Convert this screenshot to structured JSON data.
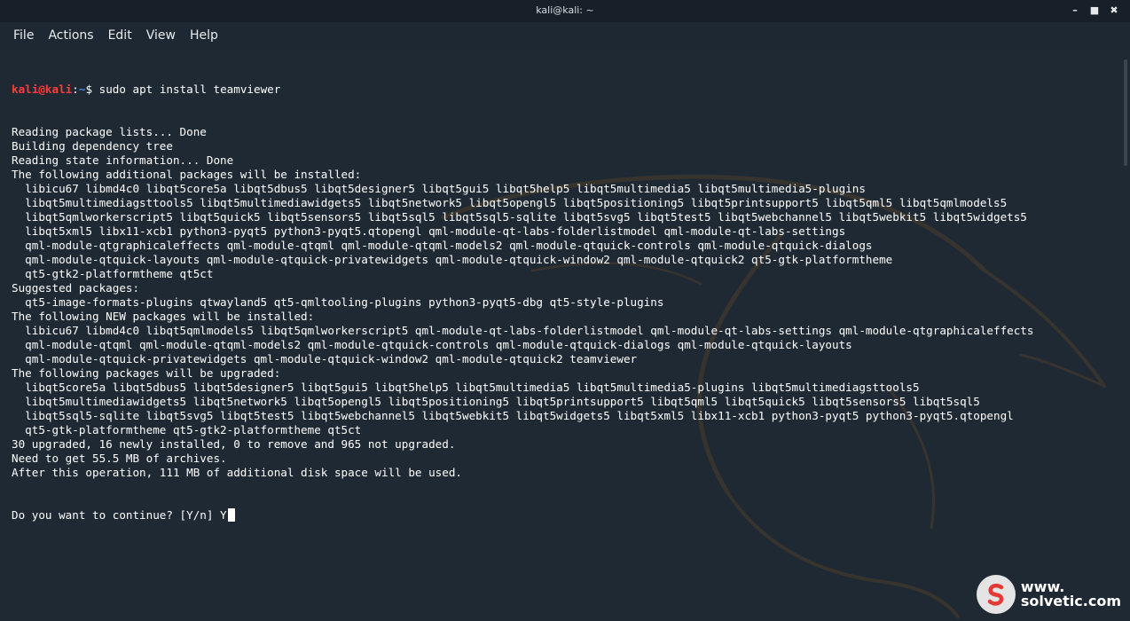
{
  "window": {
    "title": "kali@kali: ~",
    "controls": {
      "minimize": "–",
      "maximize": "■",
      "close": "✖"
    }
  },
  "menu": [
    {
      "label": "File"
    },
    {
      "label": "Actions"
    },
    {
      "label": "Edit"
    },
    {
      "label": "View"
    },
    {
      "label": "Help"
    }
  ],
  "prompt": {
    "user": "kali@kali",
    "separator": ":",
    "path": "~",
    "symbol": "$ ",
    "command": "sudo apt install teamviewer"
  },
  "output_lines": [
    "Reading package lists... Done",
    "Building dependency tree",
    "Reading state information... Done",
    "The following additional packages will be installed:",
    "  libicu67 libmd4c0 libqt5core5a libqt5dbus5 libqt5designer5 libqt5gui5 libqt5help5 libqt5multimedia5 libqt5multimedia5-plugins",
    "  libqt5multimediagsttools5 libqt5multimediawidgets5 libqt5network5 libqt5opengl5 libqt5positioning5 libqt5printsupport5 libqt5qml5 libqt5qmlmodels5",
    "  libqt5qmlworkerscript5 libqt5quick5 libqt5sensors5 libqt5sql5 libqt5sql5-sqlite libqt5svg5 libqt5test5 libqt5webchannel5 libqt5webkit5 libqt5widgets5",
    "  libqt5xml5 libx11-xcb1 python3-pyqt5 python3-pyqt5.qtopengl qml-module-qt-labs-folderlistmodel qml-module-qt-labs-settings",
    "  qml-module-qtgraphicaleffects qml-module-qtqml qml-module-qtqml-models2 qml-module-qtquick-controls qml-module-qtquick-dialogs",
    "  qml-module-qtquick-layouts qml-module-qtquick-privatewidgets qml-module-qtquick-window2 qml-module-qtquick2 qt5-gtk-platformtheme",
    "  qt5-gtk2-platformtheme qt5ct",
    "Suggested packages:",
    "  qt5-image-formats-plugins qtwayland5 qt5-qmltooling-plugins python3-pyqt5-dbg qt5-style-plugins",
    "The following NEW packages will be installed:",
    "  libicu67 libmd4c0 libqt5qmlmodels5 libqt5qmlworkerscript5 qml-module-qt-labs-folderlistmodel qml-module-qt-labs-settings qml-module-qtgraphicaleffects",
    "  qml-module-qtqml qml-module-qtqml-models2 qml-module-qtquick-controls qml-module-qtquick-dialogs qml-module-qtquick-layouts",
    "  qml-module-qtquick-privatewidgets qml-module-qtquick-window2 qml-module-qtquick2 teamviewer",
    "The following packages will be upgraded:",
    "  libqt5core5a libqt5dbus5 libqt5designer5 libqt5gui5 libqt5help5 libqt5multimedia5 libqt5multimedia5-plugins libqt5multimediagsttools5",
    "  libqt5multimediawidgets5 libqt5network5 libqt5opengl5 libqt5positioning5 libqt5printsupport5 libqt5qml5 libqt5quick5 libqt5sensors5 libqt5sql5",
    "  libqt5sql5-sqlite libqt5svg5 libqt5test5 libqt5webchannel5 libqt5webkit5 libqt5widgets5 libqt5xml5 libx11-xcb1 python3-pyqt5 python3-pyqt5.qtopengl",
    "  qt5-gtk-platformtheme qt5-gtk2-platformtheme qt5ct",
    "30 upgraded, 16 newly installed, 0 to remove and 965 not upgraded.",
    "Need to get 55.5 MB of archives.",
    "After this operation, 111 MB of additional disk space will be used."
  ],
  "question": {
    "text": "Do you want to continue? [Y/n] ",
    "answer": "Y"
  },
  "watermark": {
    "line1": "www.",
    "line2": "solvetic.com"
  },
  "colors": {
    "background": "#1f2933",
    "prompt_user": "#ff3b3b",
    "prompt_path": "#3f8fe6",
    "text": "#ffffff"
  }
}
